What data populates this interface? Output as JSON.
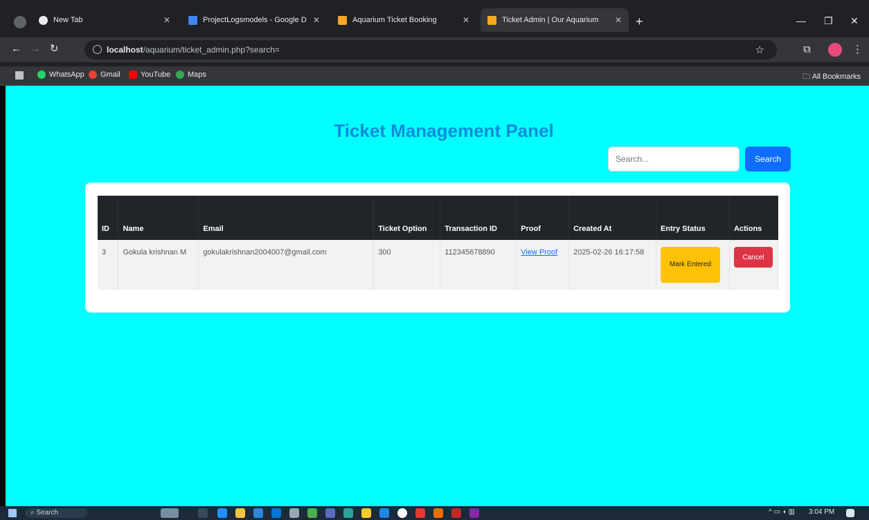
{
  "browser": {
    "tabs": [
      {
        "title": "New Tab",
        "favicon_color": "#e8eaed",
        "active": false
      },
      {
        "title": "ProjectLogsmodels - Google D",
        "favicon_color": "#4285f4",
        "active": false
      },
      {
        "title": "Aquarium Ticket Booking",
        "favicon_color": "#f5a623",
        "active": false
      },
      {
        "title": "Ticket Admin | Our Aquarium",
        "favicon_color": "#f5a623",
        "active": true
      }
    ],
    "url_host": "localhost",
    "url_path": "/aquarium/ticket_admin.php?search=",
    "bookmarks": [
      {
        "label": "WhatsApp",
        "color": "#25d366"
      },
      {
        "label": "Gmail",
        "color": "#ea4335"
      },
      {
        "label": "YouTube",
        "color": "#ff0000"
      },
      {
        "label": "Maps",
        "color": "#34a853"
      }
    ],
    "all_bookmarks_label": "All Bookmarks"
  },
  "page": {
    "title": "Ticket Management Panel",
    "search": {
      "placeholder": "Search...",
      "button_label": "Search"
    },
    "table": {
      "headers": {
        "id": "ID",
        "name": "Name",
        "email": "Email",
        "ticket_option": "Ticket Option",
        "transaction_id": "Transaction ID",
        "proof": "Proof",
        "created_at": "Created At",
        "entry_status": "Entry Status",
        "actions": "Actions"
      },
      "rows": [
        {
          "id": "3",
          "name": "Gokula krishnan M",
          "email": "gokulakrishnan2004007@gmail.com",
          "ticket_option": "300",
          "transaction_id": "112345678890",
          "proof_link": "View Proof",
          "created_at": "2025-02-26 16:17:58",
          "entry_button": "Mark Entered",
          "action_button": "Cancel"
        }
      ]
    }
  },
  "taskbar": {
    "search_label": "Search",
    "time": "3:04 PM"
  },
  "colors": {
    "page_background": "#00ffff",
    "title": "#0d8bd9",
    "primary": "#0d6efd",
    "warning": "#ffc107",
    "danger": "#dc3545",
    "table_header": "#212529"
  }
}
